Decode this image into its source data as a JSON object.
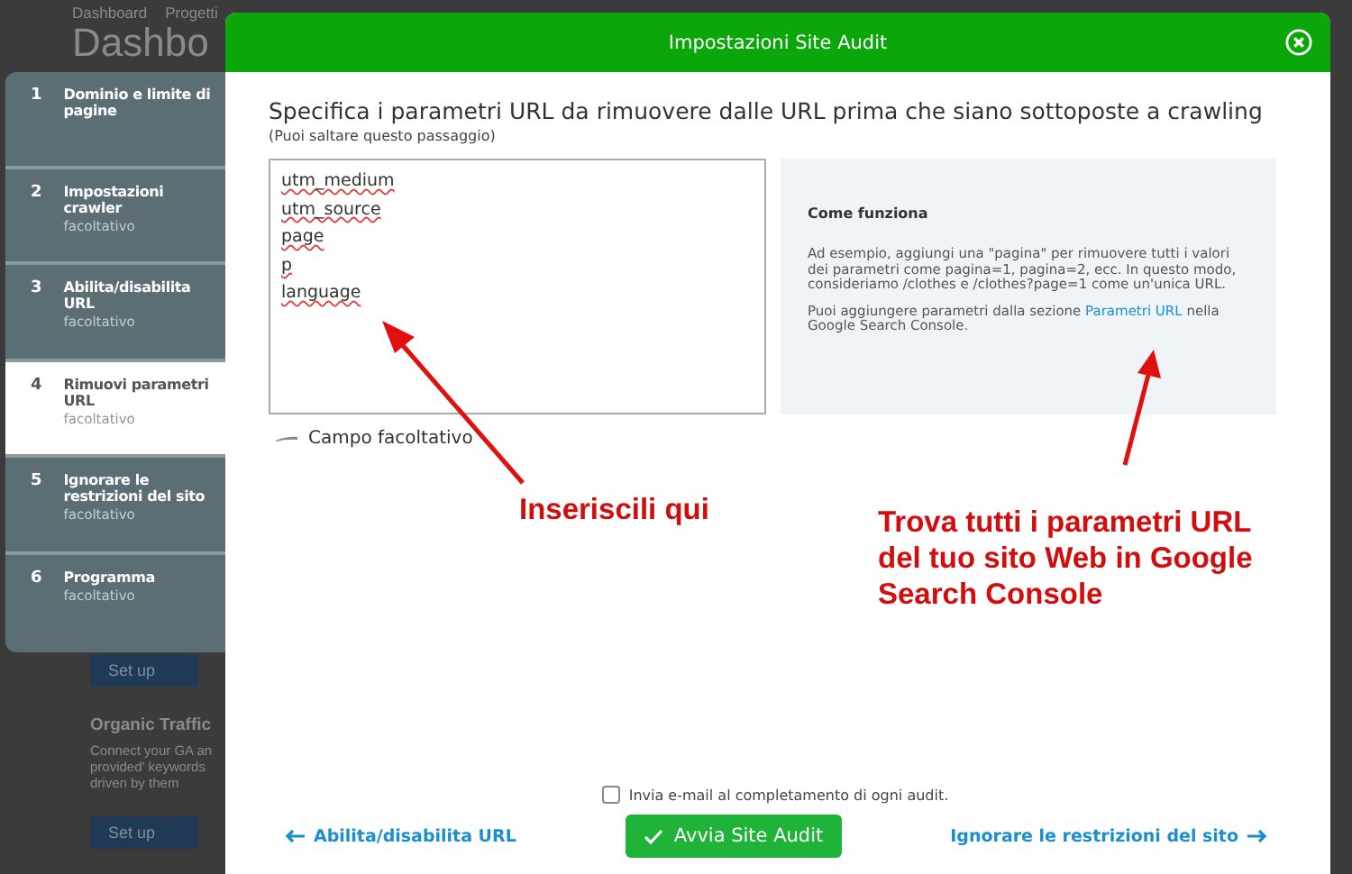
{
  "background_page": {
    "breadcrumb": [
      "Dashboard",
      "Progetti"
    ],
    "heading": "Dashbo",
    "setup_buttons": [
      "Set up",
      "Set up"
    ],
    "card_title": "Organic Traffic",
    "card_text": [
      "Connect your GA an",
      "provided' keywords",
      "driven by them"
    ]
  },
  "steps": [
    {
      "number": "1",
      "title": "Dominio e limite di pagine",
      "selected": false
    },
    {
      "number": "2",
      "title": "Impostazioni crawler",
      "note": "facoltativo",
      "selected": false
    },
    {
      "number": "3",
      "title": "Abilita/disabilita URL",
      "note": "facoltativo",
      "selected": false
    },
    {
      "number": "4",
      "title": "Rimuovi parametri URL",
      "note": "facoltativo",
      "selected": true
    },
    {
      "number": "5",
      "title": "Ignorare le restrizioni del sito",
      "note": "facoltativo",
      "selected": false
    },
    {
      "number": "6",
      "title": "Programma",
      "note": "facoltativo",
      "selected": false
    }
  ],
  "dialog": {
    "title": "Impostazioni Site Audit",
    "heading": "Specifica i parametri URL da rimuovere dalle URL prima che siano sottoposte a crawling",
    "subheading": "(Puoi saltare questo passaggio)",
    "parameters_field": {
      "value": "utm_medium\nutm_source\npage\np\nlanguage"
    },
    "field_note": "Campo facoltativo",
    "info": {
      "title": "Come funziona",
      "text": "Ad esempio, aggiungi una \"pagina\" per rimuovere tutti i valori dei parametri come pagina=1, pagina=2, ecc. In questo modo, consideriamo /clothes e /clothes?page=1 come un'unica URL.",
      "text2_before": "Puoi aggiungere parametri dalla sezione",
      "link": "Parametri URL",
      "text2_after": "nella Google Search Console."
    },
    "email_checkbox": {
      "label": "Invia e-mail al completamento di ogni audit.",
      "checked": false
    },
    "back_link": "Abilita/disabilita URL",
    "start_button": "Avvia Site Audit",
    "next_link": "Ignorare le restrizioni del sito"
  },
  "annotations": [
    "Inseriscili qui",
    "Trova tutti i parametri URL del tuo sito Web in Google Search Console"
  ]
}
